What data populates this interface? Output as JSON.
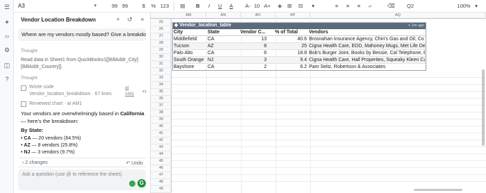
{
  "toolbar": {
    "cell_ref": "A3",
    "zoom": "100%",
    "font_size": "10",
    "buttons": [
      "99",
      "99",
      "$",
      "%",
      "123",
      "B",
      "I",
      "U",
      "A",
      "A-",
      "A+",
      "Q2"
    ]
  },
  "panel": {
    "title": "Vendor Location Breakdown",
    "user_question": "Where are my vendors mostly based? Give a breakdown",
    "thought1_label": "Thought",
    "thought1_text": "Read data in Sheet1 from QuickBooks1[[BillAddr_City]:[BillAddr_Country]].",
    "thought2_label": "Thought",
    "code_line1": "Wrote code",
    "code_line2": "Vendor_location_breakdown · 67 lines",
    "code_at": "at AM1",
    "chart_text": "Reviewed chart · at AM1",
    "answer_pre": "Your vendors are overwhelmingly based in ",
    "answer_bold": "California",
    "answer_post": " — here's the breakdown:",
    "by_state": "By State:",
    "bullets": [
      {
        "state": "CA",
        "text": " — 20 vendors (64.5%)"
      },
      {
        "state": "AZ",
        "text": " — 8 vendors (25.8%)"
      },
      {
        "state": "NJ",
        "text": " — 3 vendors (9.7%)"
      }
    ],
    "changes": "2 changes",
    "undo": "Undo",
    "input_placeholder": "Ask a question (use @ to reference the sheet)."
  },
  "grid": {
    "columns": [
      "AM",
      "AN",
      "AO",
      "AP",
      "AQ"
    ],
    "rows": [
      "25",
      "26",
      "27",
      "28",
      "29",
      "30",
      "31",
      "32",
      "33",
      "34",
      "35",
      "36",
      "37",
      "38",
      "39",
      "40",
      "41",
      "42",
      "43",
      "44",
      "45",
      "46",
      "47",
      "48",
      "49"
    ]
  },
  "table": {
    "title": "Vendor_location_table",
    "timestamp": "< 1m ago",
    "headers": [
      "City",
      "State",
      "Vendor C...",
      "% of Total",
      "Vendors"
    ],
    "rows": [
      [
        "Middlefield",
        "CA",
        "13",
        "40.6",
        "Brosnahan Insurance Agency, Chin's Gas and Oil, Co"
      ],
      [
        "Tucson",
        "AZ",
        "8",
        "25",
        "Cigna Health Care, EDD, Mahoney Mugs, Met Life De"
      ],
      [
        "Palo Alto",
        "CA",
        "6",
        "18.8",
        "Bob's Burger Joint, Books by Bessie, Cal Telephone, E"
      ],
      [
        "South Orange",
        "NJ",
        "3",
        "9.4",
        "Cigna Health Care, Hall Properties, Squeaky Kleen Ca"
      ],
      [
        "Bayshore",
        "CA",
        "2",
        "6.2",
        "Pam Seitz, Robertson & Associates"
      ]
    ]
  }
}
